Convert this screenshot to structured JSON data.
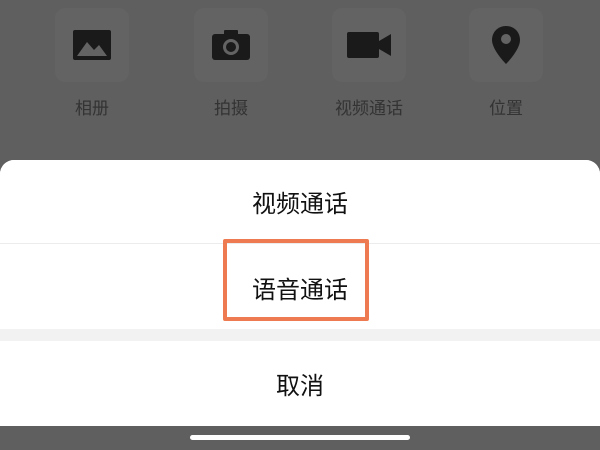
{
  "attachment_panel": {
    "items": [
      {
        "label": "相册",
        "icon": "photo-album-icon"
      },
      {
        "label": "拍摄",
        "icon": "camera-icon"
      },
      {
        "label": "视频通话",
        "icon": "video-camera-icon"
      },
      {
        "label": "位置",
        "icon": "location-pin-icon"
      }
    ]
  },
  "action_sheet": {
    "video_call": "视频通话",
    "voice_call": "语音通话",
    "cancel": "取消"
  },
  "colors": {
    "overlay": "#5f5f5f",
    "sheet": "#ffffff",
    "highlight": "#ee7a52"
  }
}
